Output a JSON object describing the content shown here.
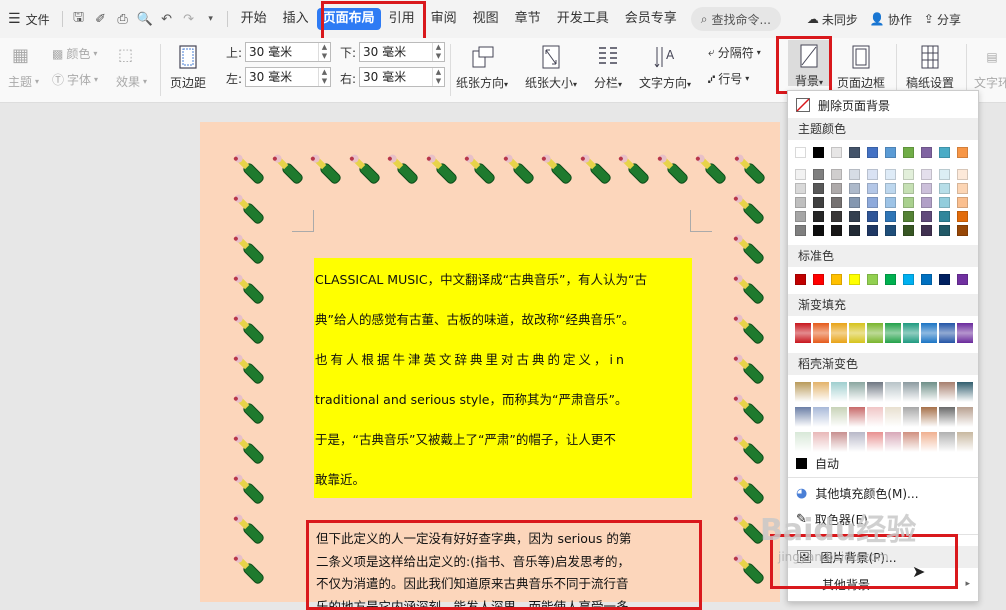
{
  "tabs": {
    "file": "文件",
    "items": [
      "开始",
      "插入",
      "页面布局",
      "引用",
      "审阅",
      "视图",
      "章节",
      "开发工具",
      "会员专享"
    ],
    "search": "查找命令...",
    "sync": "未同步",
    "collab": "协作",
    "share": "分享"
  },
  "ribbon": {
    "theme": "主题",
    "theme_color": "颜色",
    "theme_font": "字体",
    "theme_effect": "效果",
    "margin": "页边距",
    "top_label": "上:",
    "bottom_label": "下:",
    "left_label": "左:",
    "right_label": "右:",
    "top": "30 毫米",
    "bottom": "30 毫米",
    "left": "30 毫米",
    "right": "30 毫米",
    "orientation": "纸张方向",
    "size": "纸张大小",
    "columns": "分栏",
    "text_dir": "文字方向",
    "separator": "分隔符",
    "line_no": "行号",
    "background": "背景",
    "page_border": "页面边框",
    "grid_setting": "稿纸设置",
    "text_wrap": "文字环"
  },
  "document": {
    "yellow_lines": [
      "CLASSICAL MUSIC，中文翻译成“古典音乐”，有人认为“古",
      "典”给人的感觉有古董、古板的味道，故改称“经典音乐”。",
      "也有人根据牛津英文辞典里对古典的定义，in",
      "traditional and serious style，而称其为“严肃音乐”。",
      "于是，“古典音乐”又被戴上了“严肃”的帽子，让人更不",
      "敢靠近。"
    ],
    "red_lines": [
      "但下此定义的人一定没有好好查字典，因为 serious 的第",
      "二条义项是这样给出定义的:(指书、音乐等)启发思考的，",
      "不仅为消遣的。因此我们知道原来古典音乐不同于流行音",
      "乐的地方是它内涵深刻，能发人深思，而能使人享受一多"
    ]
  },
  "menu": {
    "delete_bg": "删除页面背景",
    "theme_colors": "主题颜色",
    "standard_colors": "标准色",
    "gradient": "渐变填充",
    "wps_gradient": "稻壳渐变色",
    "auto": "自动",
    "more_colors": "其他填充颜色(M)...",
    "eyedropper": "取色器(E)",
    "picture_bg": "图片背景(P)...",
    "other_bg": "其他背景",
    "theme_top": [
      "#ffffff",
      "#000000",
      "#e7e6e6",
      "#44546a",
      "#4472c4",
      "#5b9bd5",
      "#70ad47",
      "#8064a2",
      "#4bacc6",
      "#f79646"
    ],
    "theme_shades": [
      [
        "#f2f2f2",
        "#7f7f7f",
        "#d0cece",
        "#d6dce5",
        "#d9e2f3",
        "#deebf7",
        "#e2efda",
        "#e4dfec",
        "#dbeef4",
        "#fde9d9"
      ],
      [
        "#d9d9d9",
        "#595959",
        "#aeaaaa",
        "#adb9ca",
        "#b4c7e7",
        "#bdd7ee",
        "#c6e0b4",
        "#ccc0da",
        "#b7dee8",
        "#fcd5b4"
      ],
      [
        "#bfbfbf",
        "#404040",
        "#757171",
        "#8497b0",
        "#8eaadb",
        "#9dc3e6",
        "#a9d08e",
        "#b1a0c7",
        "#92cddc",
        "#fabf8f"
      ],
      [
        "#a6a6a6",
        "#262626",
        "#3a3838",
        "#333f4f",
        "#2f5597",
        "#2e75b6",
        "#548235",
        "#604a7b",
        "#31869b",
        "#e26b0a"
      ],
      [
        "#7f7f7f",
        "#0d0d0d",
        "#171616",
        "#222a35",
        "#1f3864",
        "#1f4e79",
        "#375623",
        "#403151",
        "#215967",
        "#974706"
      ]
    ],
    "standard": [
      "#c00000",
      "#ff0000",
      "#ffc000",
      "#ffff00",
      "#92d050",
      "#00b050",
      "#00b0f0",
      "#0070c0",
      "#002060",
      "#7030a0"
    ],
    "gradients": [
      "#c8161d",
      "#e55a1a",
      "#e8a317",
      "#d6c31c",
      "#7ab52d",
      "#23a14a",
      "#1e9a80",
      "#1b74c4",
      "#2354a6",
      "#6a2a9c"
    ],
    "wps_rows": [
      [
        "#b99a5a",
        "#e3b36a",
        "#9fcfcf",
        "#8aa6a0",
        "#6f7782",
        "#b8c4c8",
        "#8b9aa0",
        "#6e8f88",
        "#a67f6e",
        "#315e6e"
      ],
      [
        "#6b7fa6",
        "#a8b9d8",
        "#c8d3b8",
        "#c86a6a",
        "#f0c6c6",
        "#e8e0d0",
        "#a8a8a8",
        "#a6714a",
        "#6a6a6a",
        "#b8a090"
      ],
      [
        "#d8e8d8",
        "#e8b8b8",
        "#c89090",
        "#b8b8c8",
        "#e89090",
        "#d8a8b8",
        "#d09080",
        "#f0b090",
        "#b0b0b0",
        "#c8b8a0"
      ]
    ]
  },
  "watermark": {
    "logo": "Baidu经验",
    "url": "jingyan.baidu.com"
  }
}
